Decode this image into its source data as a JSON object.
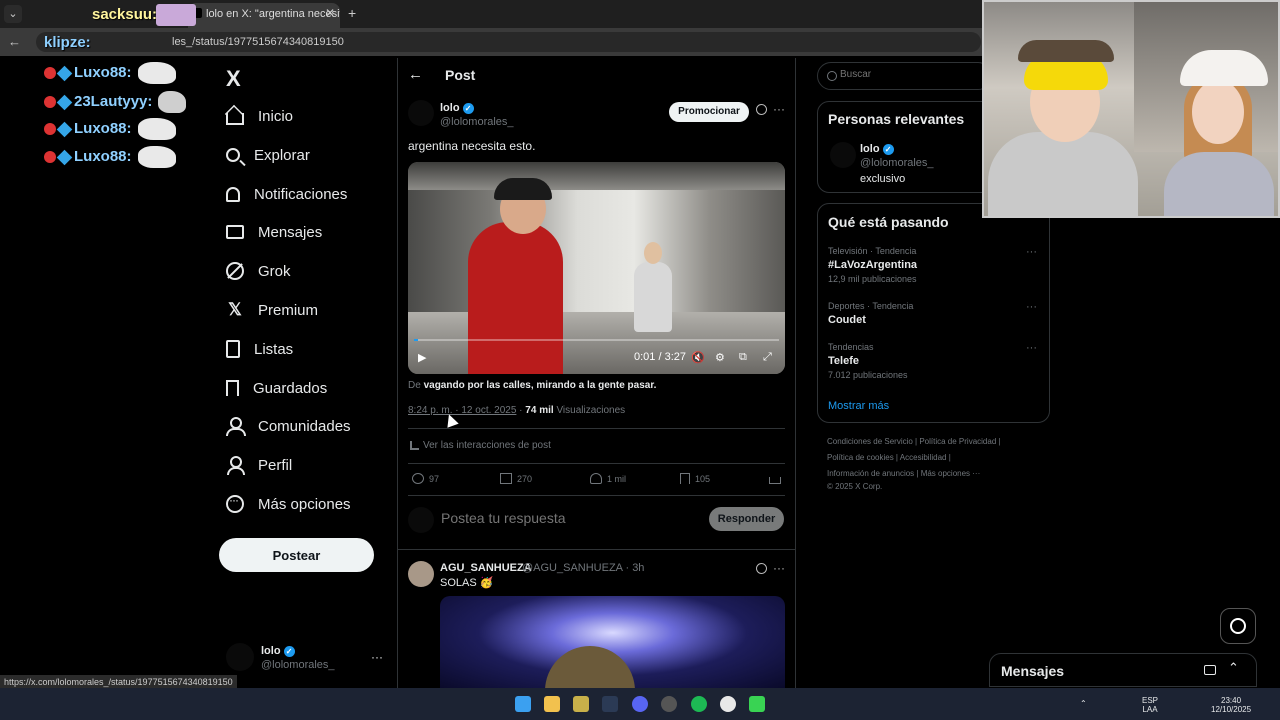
{
  "browser": {
    "tab_active_title": "lolo en X: \"argentina necesita e",
    "url": "les_/status/1977515674340819150",
    "status_url": "https://x.com/lolomorales_/status/1977515674340819150"
  },
  "overlay": {
    "top_name": "sacksuu:",
    "klip_name": "klipze:",
    "chat": [
      {
        "name": "Luxo88:"
      },
      {
        "name": "23Lautyyy:"
      },
      {
        "name": "Luxo88:"
      },
      {
        "name": "Luxo88:"
      }
    ]
  },
  "nav": {
    "logo": "X",
    "items": [
      {
        "label": "Inicio",
        "icon": "home-icon"
      },
      {
        "label": "Explorar",
        "icon": "search-icon"
      },
      {
        "label": "Notificaciones",
        "icon": "bell-icon"
      },
      {
        "label": "Mensajes",
        "icon": "mail-icon"
      },
      {
        "label": "Grok",
        "icon": "grok-icon"
      },
      {
        "label": "Premium",
        "icon": "x-icon"
      },
      {
        "label": "Listas",
        "icon": "list-icon"
      },
      {
        "label": "Guardados",
        "icon": "bookmark-icon"
      },
      {
        "label": "Comunidades",
        "icon": "communities-icon"
      },
      {
        "label": "Perfil",
        "icon": "profile-icon"
      },
      {
        "label": "Más opciones",
        "icon": "more-icon"
      }
    ],
    "post_button": "Postear",
    "account": {
      "name": "lolo",
      "handle": "@lolomorales_"
    }
  },
  "post": {
    "header_title": "Post",
    "author_name": "lolo",
    "author_handle": "@lolomorales_",
    "promote_label": "Promocionar",
    "text": "argentina necesita esto.",
    "video": {
      "time": "0:01 / 3:27",
      "progress": 0.005
    },
    "from_prefix": "De",
    "from_source": "vagando por las calles, mirando a la gente pasar.",
    "timestamp": "8:24 p. m. · 12 oct. 2025",
    "views_count": "74 mil",
    "views_label": "Visualizaciones",
    "interactions_label": "Ver las interacciones de post",
    "actions": {
      "replies": "97",
      "reposts": "270",
      "likes": "1 mil",
      "bookmarks": "105"
    },
    "reply_placeholder": "Postea tu respuesta",
    "reply_button": "Responder"
  },
  "reply": {
    "name": "AGU_SANHUEZA",
    "handle": "@AGU_SANHUEZA · 3h",
    "text": "SOLAS 🥳"
  },
  "sidebar": {
    "search_placeholder": "Buscar",
    "relevant_title": "Personas relevantes",
    "relevant": {
      "name": "lolo",
      "handle": "@lolomorales_",
      "bio": "exclusivo"
    },
    "trends_title": "Qué está pasando",
    "trends": [
      {
        "meta": "Televisión · Tendencia",
        "name": "#LaVozArgentina",
        "count": "12,9 mil publicaciones"
      },
      {
        "meta": "Deportes · Tendencia",
        "name": "Coudet",
        "count": ""
      },
      {
        "meta": "Tendencias",
        "name": "Telefe",
        "count": "7.012 publicaciones"
      }
    ],
    "show_more": "Mostrar más",
    "footer": {
      "line1": "Condiciones de Servicio  |  Política de Privacidad  |",
      "line2": "Política de cookies  |  Accesibilidad  |",
      "line3": "Información de anuncios  |  Más opciones ···",
      "line4": "© 2025 X Corp."
    }
  },
  "messages": {
    "title": "Mensajes"
  },
  "taskbar": {
    "lang_top": "ESP",
    "lang_bottom": "LAA",
    "time": "23:40",
    "date": "12/10/2025"
  },
  "colors": {
    "accent": "#1d9bf0",
    "background": "#000000",
    "text": "#e7e9ea",
    "muted": "#71767b"
  }
}
